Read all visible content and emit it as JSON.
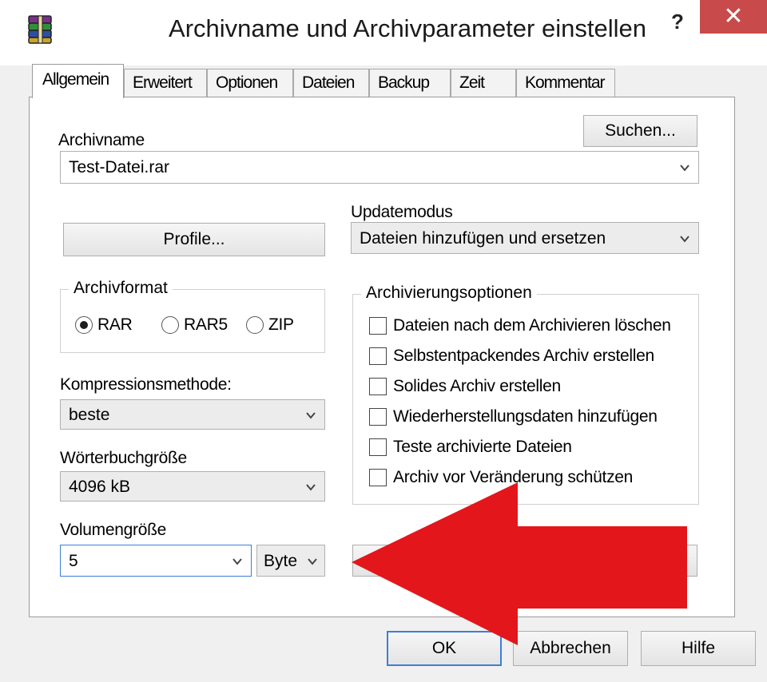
{
  "window": {
    "title": "Archivname und Archivparameter einstellen",
    "help_label": "?",
    "close_label": "✕"
  },
  "tabs": [
    {
      "label": "Allgemein",
      "active": true
    },
    {
      "label": "Erweitert"
    },
    {
      "label": "Optionen"
    },
    {
      "label": "Dateien"
    },
    {
      "label": "Backup"
    },
    {
      "label": "Zeit"
    },
    {
      "label": "Kommentar"
    }
  ],
  "archive": {
    "label": "Archivname",
    "value": "Test-Datei.rar",
    "browse_label": "Suchen..."
  },
  "profiles_label": "Profile...",
  "update_mode": {
    "label": "Updatemodus",
    "value": "Dateien hinzufügen und ersetzen"
  },
  "format": {
    "title": "Archivformat",
    "options": [
      {
        "label": "RAR",
        "checked": true
      },
      {
        "label": "RAR5",
        "checked": false
      },
      {
        "label": "ZIP",
        "checked": false
      }
    ]
  },
  "archiving_options": {
    "title": "Archivierungsoptionen",
    "items": [
      {
        "label": "Dateien nach dem Archivieren löschen",
        "checked": false
      },
      {
        "label": "Selbstentpackendes Archiv erstellen",
        "checked": false
      },
      {
        "label": "Solides Archiv erstellen",
        "checked": false
      },
      {
        "label": "Wiederherstellungsdaten hinzufügen",
        "checked": false
      },
      {
        "label": "Teste archivierte Dateien",
        "checked": false
      },
      {
        "label": "Archiv vor Veränderung schützen",
        "checked": false
      }
    ]
  },
  "compression": {
    "label": "Kompressionsmethode:",
    "value": "beste"
  },
  "dictionary": {
    "label": "Wörterbuchgröße",
    "value": "4096 kB"
  },
  "volume": {
    "label": "Volumengröße",
    "value": "5",
    "unit": "Byte"
  },
  "footer": {
    "ok_label": "OK",
    "cancel_label": "Abbrechen",
    "help_label": "Hilfe"
  },
  "colors": {
    "close_button": "#c94a4a",
    "focus_border": "#3c7fd6",
    "arrow": "#e3161b"
  }
}
